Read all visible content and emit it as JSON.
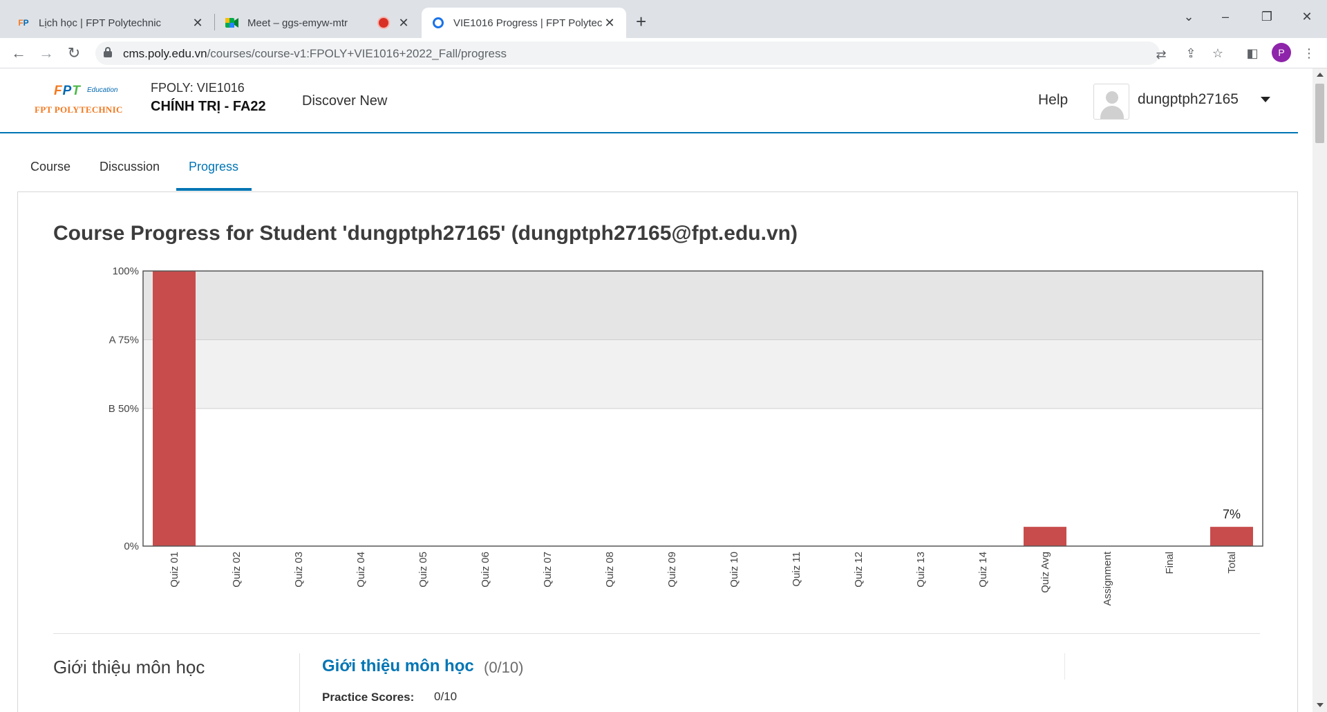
{
  "browser": {
    "tabs": [
      {
        "title": "Lịch học | FPT Polytechnic",
        "icon": "fpt-favicon-icon",
        "active": false
      },
      {
        "title": "Meet – ggs-emyw-mtr",
        "icon": "google-meet-icon",
        "active": false,
        "recording": true
      },
      {
        "title": "VIE1016 Progress | FPT Polytechnic",
        "icon": "openedx-icon",
        "active": true
      }
    ],
    "url_host": "cms.poly.edu.vn",
    "url_path": "/courses/course-v1:FPOLY+VIE1016+2022_Fall/progress",
    "profile_initial": "P",
    "profile_color": "#8e24aa"
  },
  "header": {
    "logo_text": "FPT",
    "logo_subtext": "Education",
    "logo_name": "FPT POLYTECHNIC",
    "course_org": "FPOLY: VIE1016",
    "course_name": "CHÍNH TRỊ - FA22",
    "discover_label": "Discover New",
    "help_label": "Help",
    "username": "dungptph27165"
  },
  "course_tabs": [
    {
      "label": "Course",
      "active": false
    },
    {
      "label": "Discussion",
      "active": false
    },
    {
      "label": "Progress",
      "active": true
    }
  ],
  "progress": {
    "title": "Course Progress for Student 'dungptph27165' (dungptph27165@fpt.edu.vn)"
  },
  "chart_data": {
    "type": "bar",
    "categories": [
      "Quiz 01",
      "Quiz 02",
      "Quiz 03",
      "Quiz 04",
      "Quiz 05",
      "Quiz 06",
      "Quiz 07",
      "Quiz 08",
      "Quiz 09",
      "Quiz 10",
      "Quiz 11",
      "Quiz 12",
      "Quiz 13",
      "Quiz 14",
      "Quiz Avg",
      "Assignment",
      "Final",
      "Total"
    ],
    "values": [
      100,
      0,
      0,
      0,
      0,
      0,
      0,
      0,
      0,
      0,
      0,
      0,
      0,
      0,
      7,
      0,
      0,
      7
    ],
    "ylim": [
      0,
      100
    ],
    "yticks": [
      {
        "value": 100,
        "label": "100%"
      },
      {
        "value": 75,
        "label": "A 75%"
      },
      {
        "value": 50,
        "label": "B 50%"
      },
      {
        "value": 0,
        "label": "0%"
      }
    ],
    "grade_bands": [
      {
        "from": 75,
        "to": 100,
        "color": "#e5e5e5"
      },
      {
        "from": 50,
        "to": 75,
        "color": "#f1f1f1"
      }
    ],
    "data_labels": [
      {
        "category": "Total",
        "label": "7%"
      }
    ],
    "bar_color": "#c84c4c",
    "grid": false,
    "title": "",
    "xlabel": "",
    "ylabel": ""
  },
  "chapter": {
    "title": "Giới thiệu môn học",
    "section_title": "Giới thiệu môn học",
    "section_score": "(0/10)",
    "practice_label": "Practice Scores:",
    "practice_value": "0/10"
  }
}
